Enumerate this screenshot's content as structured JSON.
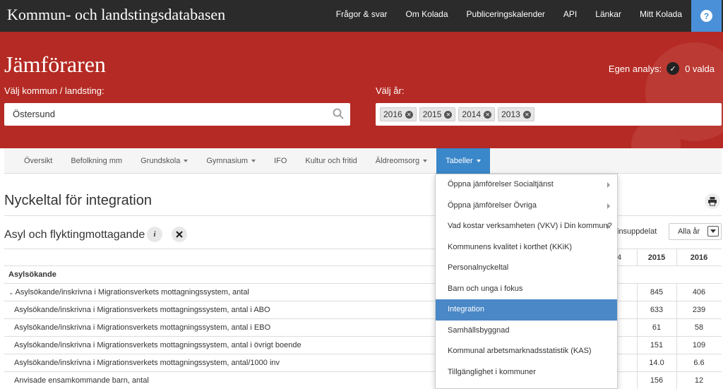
{
  "topbar": {
    "brand": "Kommun- och landstingsdatabasen",
    "nav": [
      "Frågor & svar",
      "Om Kolada",
      "Publiceringskalender",
      "API",
      "Länkar",
      "Mitt Kolada"
    ],
    "help_label": "?"
  },
  "hero": {
    "title": "Jämföraren",
    "egen_analys_label": "Egen analys:",
    "egen_analys_count": "0 valda",
    "kommun_label": "Välj kommun / landsting:",
    "kommun_value": "Östersund",
    "ar_label": "Välj år:",
    "years": [
      "2016",
      "2015",
      "2014",
      "2013"
    ]
  },
  "tabs": [
    "Översikt",
    "Befolkning mm",
    "Grundskola",
    "Gymnasium",
    "IFO",
    "Kultur och fritid",
    "Äldreomsorg",
    "Tabeller"
  ],
  "main": {
    "page_title": "Nyckeltal för integration",
    "section_title": "Asyl och flyktingmottagande",
    "insuppdelat_fragment": "insuppdelat",
    "year_filter": "Alla år",
    "col_fragment": "4",
    "columns": [
      "2015",
      "2016"
    ]
  },
  "table": {
    "group_label": "Asylsökande",
    "rows": [
      {
        "label": "Asylsökande/inskrivna i Migrationsverkets mottagningssystem, antal",
        "v2015": "845",
        "v2016": "406",
        "expandable": true
      },
      {
        "label": "Asylsökande/inskrivna i Migrationsverkets mottagningssystem, antal i ABO",
        "v2015": "633",
        "v2016": "239"
      },
      {
        "label": "Asylsökande/inskrivna i Migrationsverkets mottagningssystem, antal i EBO",
        "v2015": "61",
        "v2016": "58"
      },
      {
        "label": "Asylsökande/inskrivna i Migrationsverkets mottagningssystem, antal i övrigt boende",
        "v2015": "151",
        "v2016": "109"
      },
      {
        "label": "Asylsökande/inskrivna i Migrationsverkets mottagningssystem, antal/1000 inv",
        "v2015": "14.0",
        "v2016": "6.6"
      },
      {
        "label": "Anvisade ensamkommande barn, antal",
        "v2015": "156",
        "v2016": "12"
      }
    ]
  },
  "dropdown": {
    "items": [
      {
        "label": "Öppna jämförelser Socialtjänst",
        "submenu": true
      },
      {
        "label": "Öppna jämförelser Övriga",
        "submenu": true
      },
      {
        "label": "Vad kostar verksamheten (VKV) i Din kommun?",
        "submenu": true
      },
      {
        "label": "Kommunens kvalitet i korthet (KKiK)"
      },
      {
        "label": "Personalnyckeltal"
      },
      {
        "label": "Barn och unga i fokus"
      },
      {
        "label": "Integration",
        "active": true
      },
      {
        "label": "Samhällsbyggnad"
      },
      {
        "label": "Kommunal arbetsmarknadsstatistik (KAS)"
      },
      {
        "label": "Tillgänglighet i kommuner"
      }
    ]
  },
  "colors": {
    "topbar": "#2b2b2b",
    "hero": "#b52a24",
    "accent": "#3a87c9"
  }
}
